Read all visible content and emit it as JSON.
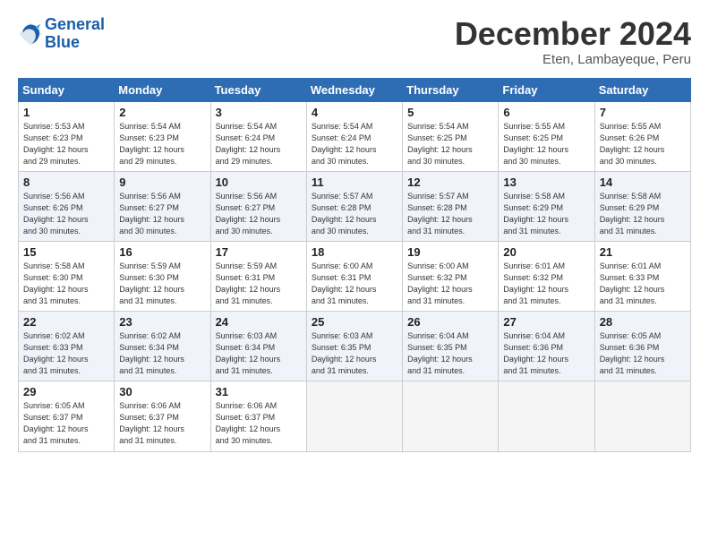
{
  "header": {
    "logo_line1": "General",
    "logo_line2": "Blue",
    "month": "December 2024",
    "location": "Eten, Lambayeque, Peru"
  },
  "weekdays": [
    "Sunday",
    "Monday",
    "Tuesday",
    "Wednesday",
    "Thursday",
    "Friday",
    "Saturday"
  ],
  "weeks": [
    [
      {
        "day": "1",
        "info": "Sunrise: 5:53 AM\nSunset: 6:23 PM\nDaylight: 12 hours\nand 29 minutes."
      },
      {
        "day": "2",
        "info": "Sunrise: 5:54 AM\nSunset: 6:23 PM\nDaylight: 12 hours\nand 29 minutes."
      },
      {
        "day": "3",
        "info": "Sunrise: 5:54 AM\nSunset: 6:24 PM\nDaylight: 12 hours\nand 29 minutes."
      },
      {
        "day": "4",
        "info": "Sunrise: 5:54 AM\nSunset: 6:24 PM\nDaylight: 12 hours\nand 30 minutes."
      },
      {
        "day": "5",
        "info": "Sunrise: 5:54 AM\nSunset: 6:25 PM\nDaylight: 12 hours\nand 30 minutes."
      },
      {
        "day": "6",
        "info": "Sunrise: 5:55 AM\nSunset: 6:25 PM\nDaylight: 12 hours\nand 30 minutes."
      },
      {
        "day": "7",
        "info": "Sunrise: 5:55 AM\nSunset: 6:26 PM\nDaylight: 12 hours\nand 30 minutes."
      }
    ],
    [
      {
        "day": "8",
        "info": "Sunrise: 5:56 AM\nSunset: 6:26 PM\nDaylight: 12 hours\nand 30 minutes."
      },
      {
        "day": "9",
        "info": "Sunrise: 5:56 AM\nSunset: 6:27 PM\nDaylight: 12 hours\nand 30 minutes."
      },
      {
        "day": "10",
        "info": "Sunrise: 5:56 AM\nSunset: 6:27 PM\nDaylight: 12 hours\nand 30 minutes."
      },
      {
        "day": "11",
        "info": "Sunrise: 5:57 AM\nSunset: 6:28 PM\nDaylight: 12 hours\nand 30 minutes."
      },
      {
        "day": "12",
        "info": "Sunrise: 5:57 AM\nSunset: 6:28 PM\nDaylight: 12 hours\nand 31 minutes."
      },
      {
        "day": "13",
        "info": "Sunrise: 5:58 AM\nSunset: 6:29 PM\nDaylight: 12 hours\nand 31 minutes."
      },
      {
        "day": "14",
        "info": "Sunrise: 5:58 AM\nSunset: 6:29 PM\nDaylight: 12 hours\nand 31 minutes."
      }
    ],
    [
      {
        "day": "15",
        "info": "Sunrise: 5:58 AM\nSunset: 6:30 PM\nDaylight: 12 hours\nand 31 minutes."
      },
      {
        "day": "16",
        "info": "Sunrise: 5:59 AM\nSunset: 6:30 PM\nDaylight: 12 hours\nand 31 minutes."
      },
      {
        "day": "17",
        "info": "Sunrise: 5:59 AM\nSunset: 6:31 PM\nDaylight: 12 hours\nand 31 minutes."
      },
      {
        "day": "18",
        "info": "Sunrise: 6:00 AM\nSunset: 6:31 PM\nDaylight: 12 hours\nand 31 minutes."
      },
      {
        "day": "19",
        "info": "Sunrise: 6:00 AM\nSunset: 6:32 PM\nDaylight: 12 hours\nand 31 minutes."
      },
      {
        "day": "20",
        "info": "Sunrise: 6:01 AM\nSunset: 6:32 PM\nDaylight: 12 hours\nand 31 minutes."
      },
      {
        "day": "21",
        "info": "Sunrise: 6:01 AM\nSunset: 6:33 PM\nDaylight: 12 hours\nand 31 minutes."
      }
    ],
    [
      {
        "day": "22",
        "info": "Sunrise: 6:02 AM\nSunset: 6:33 PM\nDaylight: 12 hours\nand 31 minutes."
      },
      {
        "day": "23",
        "info": "Sunrise: 6:02 AM\nSunset: 6:34 PM\nDaylight: 12 hours\nand 31 minutes."
      },
      {
        "day": "24",
        "info": "Sunrise: 6:03 AM\nSunset: 6:34 PM\nDaylight: 12 hours\nand 31 minutes."
      },
      {
        "day": "25",
        "info": "Sunrise: 6:03 AM\nSunset: 6:35 PM\nDaylight: 12 hours\nand 31 minutes."
      },
      {
        "day": "26",
        "info": "Sunrise: 6:04 AM\nSunset: 6:35 PM\nDaylight: 12 hours\nand 31 minutes."
      },
      {
        "day": "27",
        "info": "Sunrise: 6:04 AM\nSunset: 6:36 PM\nDaylight: 12 hours\nand 31 minutes."
      },
      {
        "day": "28",
        "info": "Sunrise: 6:05 AM\nSunset: 6:36 PM\nDaylight: 12 hours\nand 31 minutes."
      }
    ],
    [
      {
        "day": "29",
        "info": "Sunrise: 6:05 AM\nSunset: 6:37 PM\nDaylight: 12 hours\nand 31 minutes."
      },
      {
        "day": "30",
        "info": "Sunrise: 6:06 AM\nSunset: 6:37 PM\nDaylight: 12 hours\nand 31 minutes."
      },
      {
        "day": "31",
        "info": "Sunrise: 6:06 AM\nSunset: 6:37 PM\nDaylight: 12 hours\nand 30 minutes."
      },
      {
        "day": "",
        "info": ""
      },
      {
        "day": "",
        "info": ""
      },
      {
        "day": "",
        "info": ""
      },
      {
        "day": "",
        "info": ""
      }
    ]
  ]
}
